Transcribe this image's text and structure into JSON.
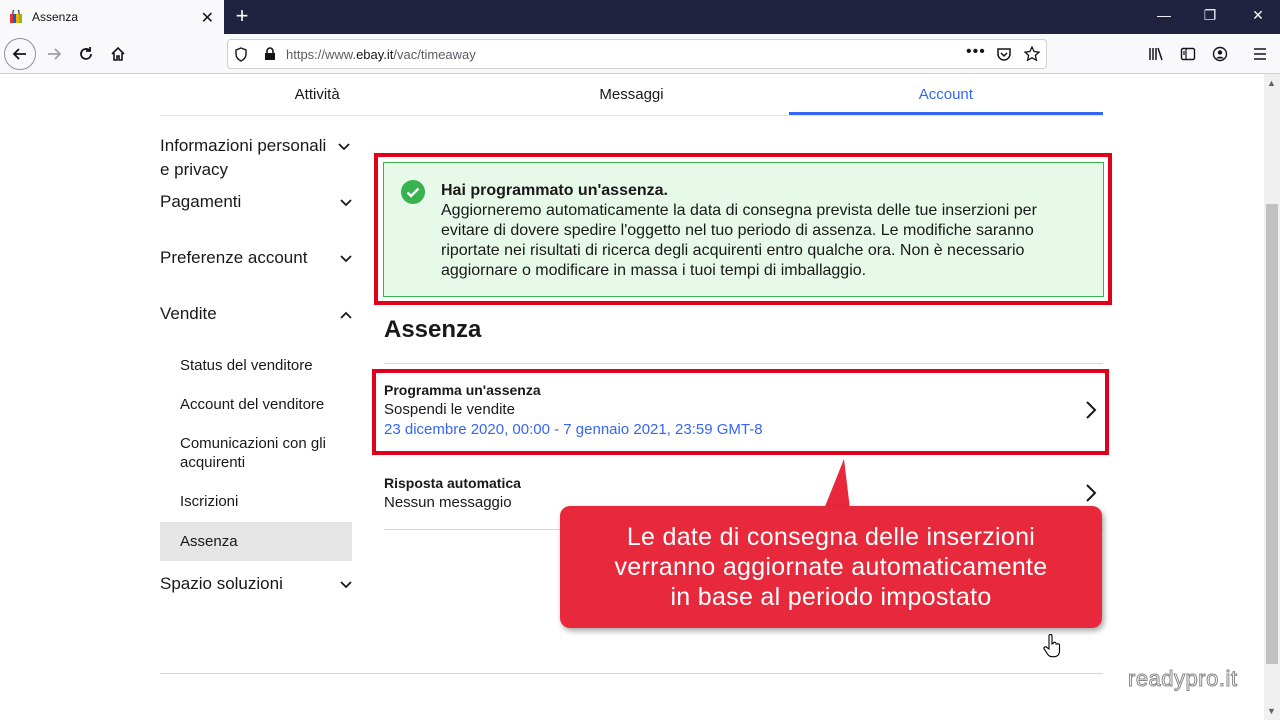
{
  "browser": {
    "tab_title": "Assenza",
    "new_tab": "+",
    "url_scheme": "https://www.",
    "url_domain": "ebay.it",
    "url_path": "/vac/timeaway"
  },
  "page_tabs": [
    {
      "label": "Attività"
    },
    {
      "label": "Messaggi"
    },
    {
      "label": "Account"
    }
  ],
  "sidebar": {
    "items": [
      {
        "label": "Informazioni personali e privacy"
      },
      {
        "label": "Pagamenti"
      },
      {
        "label": "Preferenze account"
      },
      {
        "label": "Vendite"
      },
      {
        "label": "Spazio soluzioni"
      }
    ],
    "sub_items": [
      {
        "label": "Status del venditore"
      },
      {
        "label": "Account del venditore"
      },
      {
        "label": "Comunicazioni con gli acquirenti"
      },
      {
        "label": "Iscrizioni"
      },
      {
        "label": "Assenza"
      }
    ]
  },
  "alert": {
    "title": "Hai programmato un'assenza.",
    "body": "Aggiorneremo automaticamente la data di consegna prevista delle tue inserzioni per evitare di dovere spedire l'oggetto nel tuo periodo di assenza. Le modifiche saranno riportate nei risultati di ricerca degli acquirenti entro qualche ora. Non è necessario aggiornare o modificare in massa i tuoi tempi di imballaggio."
  },
  "section": {
    "title": "Assenza",
    "rows": [
      {
        "title": "Programma un'assenza",
        "subtitle": "Sospendi le vendite",
        "date": "23 dicembre 2020, 00:00 - 7 gennaio 2021, 23:59 GMT-8"
      },
      {
        "title": "Risposta automatica",
        "subtitle": "Nessun messaggio"
      }
    ]
  },
  "callout": {
    "line1": "Le date di consegna delle inserzioni",
    "line2": "verranno aggiornate automaticamente",
    "line3": "in base al periodo impostato"
  },
  "watermark": "readypro.it",
  "colors": {
    "accent": "#3665f3",
    "highlight_red": "#e0001b",
    "callout_red": "#e8283b",
    "success_green": "#37b24d",
    "alert_bg": "#e7f9e9"
  }
}
